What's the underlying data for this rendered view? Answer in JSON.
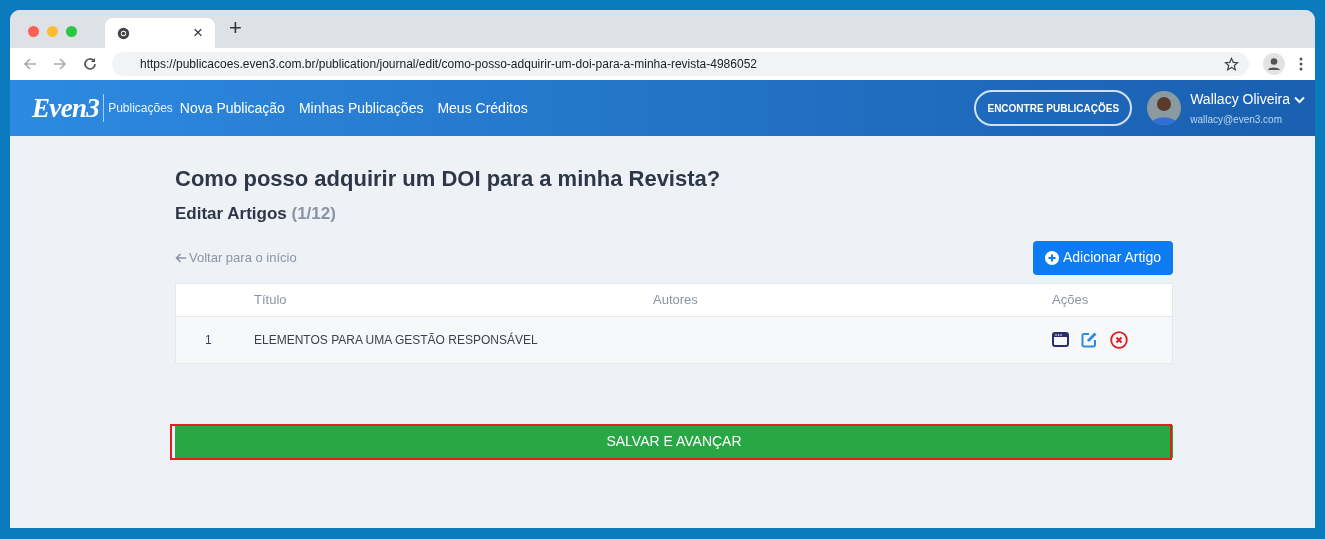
{
  "browser": {
    "tab_close": "×",
    "new_tab": "+",
    "url": "https://publicacoes.even3.com.br/publication/journal/edit/como-posso-adquirir-um-doi-para-a-minha-revista-4986052"
  },
  "header": {
    "logo": "Even3",
    "section": "Publicações",
    "nav": [
      {
        "label": "Nova Publicação"
      },
      {
        "label": "Minhas Publicações"
      },
      {
        "label": "Meus Créditos"
      }
    ],
    "find_button": "ENCONTRE PUBLICAÇÕES",
    "user_name": "Wallacy Oliveira",
    "user_email": "wallacy@even3.com"
  },
  "page": {
    "title": "Como posso adquirir um DOI para a minha Revista?",
    "subtitle": "Editar Artigos",
    "count": "(1/12)",
    "back_link": "Voltar para o início",
    "add_button": "Adicionar Artigo"
  },
  "table": {
    "columns": [
      "Título",
      "Autores",
      "Ações"
    ],
    "rows": [
      {
        "number": "1",
        "title": "ELEMENTOS PARA UMA GESTÃO RESPONSÁVEL"
      }
    ]
  },
  "save_button": {
    "label": "SALVAR E AVANÇAR",
    "highlighted": true
  }
}
